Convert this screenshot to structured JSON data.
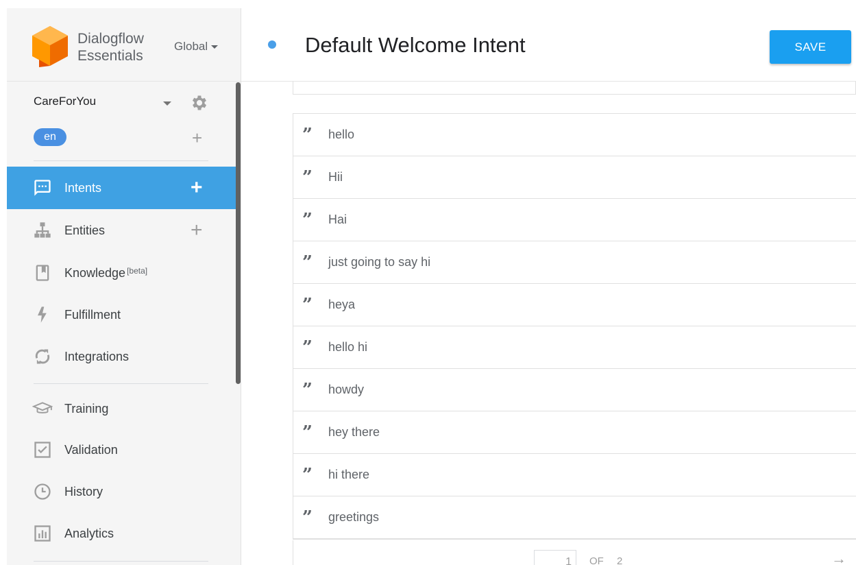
{
  "app": {
    "brand_line1": "Dialogflow",
    "brand_line2": "Essentials",
    "region": "Global",
    "brand_colors": {
      "primary": "#ff9800",
      "dark": "#e65100"
    }
  },
  "agent": {
    "name": "CareForYou",
    "language": "en"
  },
  "sidebar": {
    "items": [
      {
        "label": "Intents",
        "icon": "chat-icon",
        "active": true,
        "add": "+"
      },
      {
        "label": "Entities",
        "icon": "hierarchy-icon",
        "active": false,
        "add": "+"
      },
      {
        "label": "Knowledge",
        "icon": "book-icon",
        "active": false,
        "badge": "[beta]"
      },
      {
        "label": "Fulfillment",
        "icon": "bolt-icon",
        "active": false
      },
      {
        "label": "Integrations",
        "icon": "sync-icon",
        "active": false
      },
      {
        "label": "Training",
        "icon": "graduation-cap-icon",
        "active": false
      },
      {
        "label": "Validation",
        "icon": "checkbox-icon",
        "active": false
      },
      {
        "label": "History",
        "icon": "clock-icon",
        "active": false
      },
      {
        "label": "Analytics",
        "icon": "bar-chart-icon",
        "active": false
      }
    ],
    "accent_color": "#3fa1e3"
  },
  "header": {
    "title": "Default Welcome Intent",
    "save_label": "SAVE",
    "save_color": "#1a9ff0"
  },
  "phrases": [
    "hello",
    "Hii",
    "Hai",
    "just going to say hi",
    "heya",
    "hello hi",
    "howdy",
    "hey there",
    "hi there",
    "greetings"
  ],
  "pagination": {
    "current": "1",
    "of_label": "OF",
    "total": "2"
  }
}
